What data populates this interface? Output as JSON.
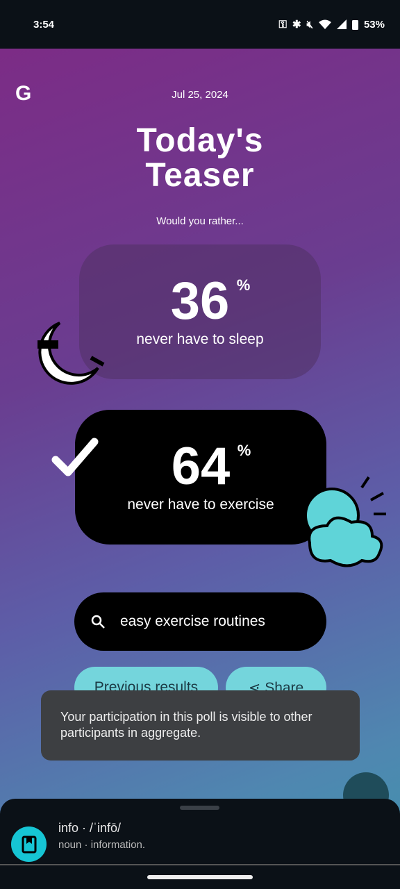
{
  "status": {
    "time": "3:54",
    "battery": "53%",
    "icons": [
      "vpn-key-icon",
      "bluetooth-icon",
      "mute-icon",
      "wifi-icon",
      "signal-icon",
      "battery-icon"
    ]
  },
  "app": {
    "logo": "G",
    "date": "Jul 25, 2024",
    "title_line1": "Today's",
    "title_line2": "Teaser",
    "subtitle": "Would you rather..."
  },
  "poll": {
    "options": [
      {
        "percent": "36",
        "unit": "%",
        "label": "never have to sleep",
        "selected": false
      },
      {
        "percent": "64",
        "unit": "%",
        "label": "never have to exercise",
        "selected": true
      }
    ]
  },
  "search": {
    "query": "easy exercise routines"
  },
  "buttons": {
    "previous": "Previous results",
    "share": "Share"
  },
  "toast": {
    "message": "Your participation in this poll is visible to other participants in aggregate."
  },
  "sheet": {
    "word": "info · /ˈinfō/",
    "definition": "noun · information."
  },
  "colors": {
    "accent": "#74d5dc",
    "dict_icon": "#16c5d4"
  }
}
